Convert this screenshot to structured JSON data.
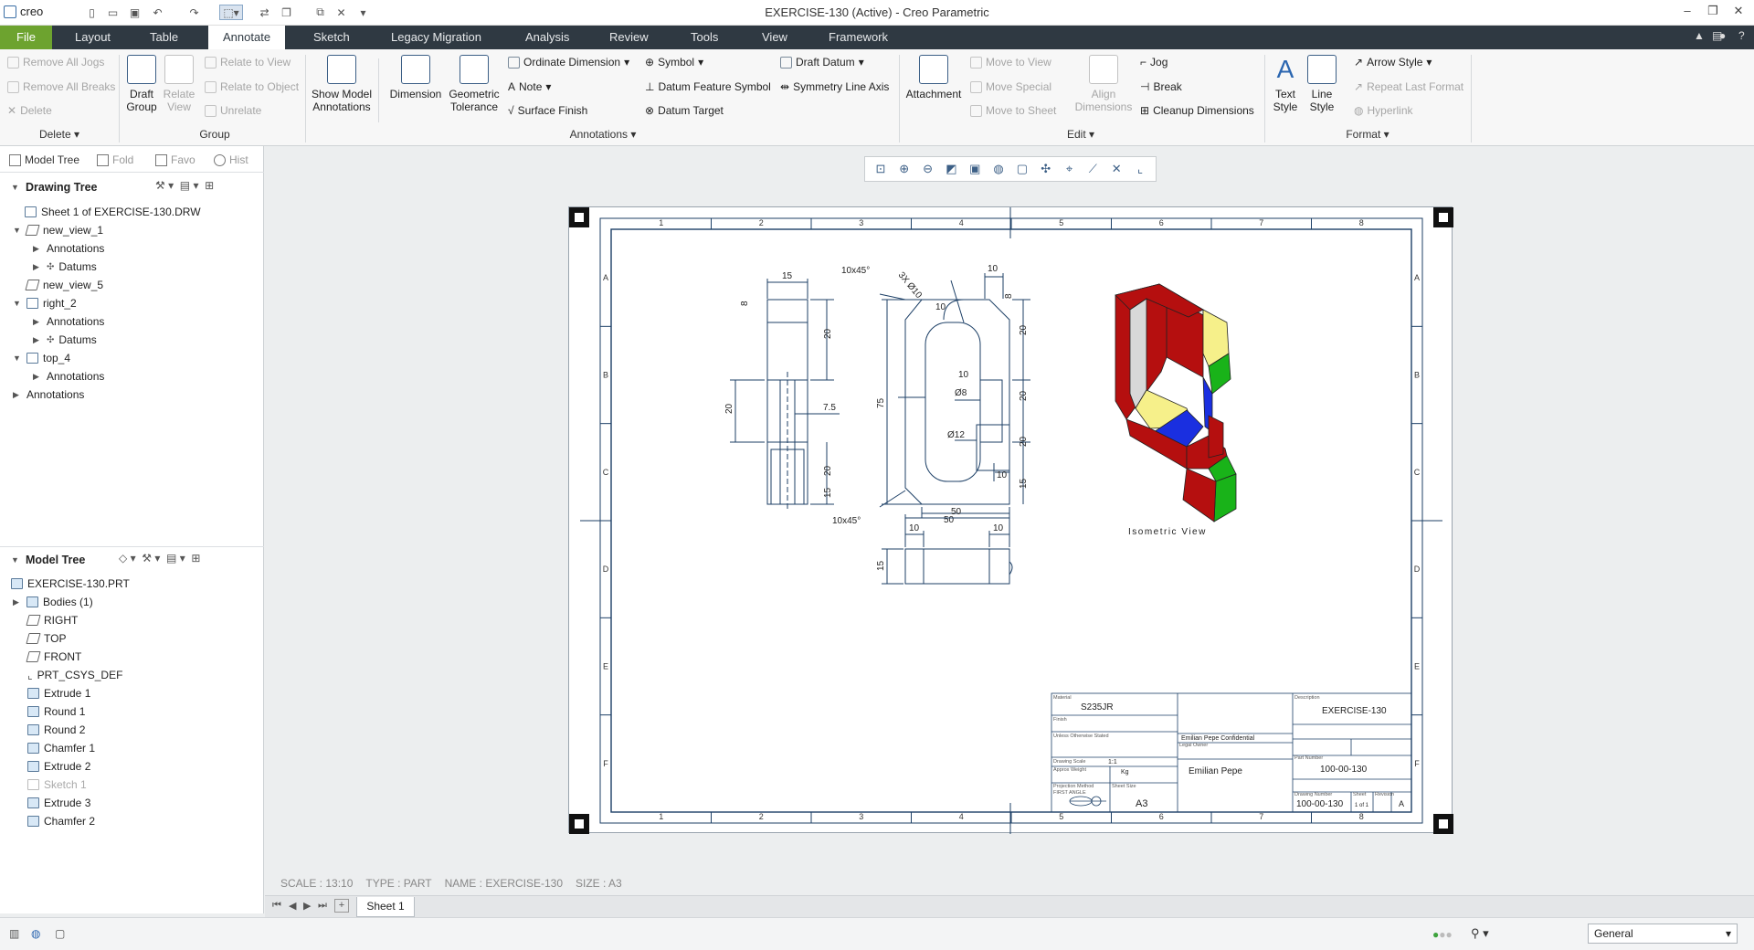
{
  "app": {
    "logo": "creo",
    "window_title": "EXERCISE-130 (Active) - Creo Parametric"
  },
  "menu": {
    "tabs": [
      "File",
      "Layout",
      "Table",
      "Annotate",
      "Sketch",
      "Legacy Migration",
      "Analysis",
      "Review",
      "Tools",
      "View",
      "Framework"
    ],
    "active_tab": "Annotate"
  },
  "ribbon": {
    "delete_group": {
      "items": [
        "Remove All Jogs",
        "Remove All Breaks",
        "Delete"
      ],
      "label": "Delete"
    },
    "group_group": {
      "draft_group": "Draft Group",
      "relate_view": "Relate View",
      "items": [
        "Relate to View",
        "Relate to Object",
        "Unrelate"
      ],
      "label": "Group"
    },
    "annotations_group": {
      "show_model": "Show Model Annotations",
      "dimension": "Dimension",
      "geometric_tolerance": "Geometric Tolerance",
      "ordinate_dimension": "Ordinate Dimension",
      "note": "Note",
      "surface_finish": "Surface Finish",
      "symbol": "Symbol",
      "datum_feature_symbol": "Datum Feature Symbol",
      "datum_target": "Datum Target",
      "draft_datum": "Draft Datum",
      "symmetry_line_axis": "Symmetry Line Axis",
      "label": "Annotations"
    },
    "edit_group": {
      "attachment": "Attachment",
      "move_items": [
        "Move to View",
        "Move Special",
        "Move to Sheet"
      ],
      "align_dimensions": "Align Dimensions",
      "jog": "Jog",
      "break": "Break",
      "cleanup": "Cleanup Dimensions",
      "label": "Edit"
    },
    "format_group": {
      "text_style": "Text Style",
      "line_style": "Line Style",
      "arrow_style": "Arrow Style",
      "repeat_last_format": "Repeat Last Format",
      "hyperlink": "Hyperlink",
      "label": "Format"
    }
  },
  "left_panel": {
    "tabs": [
      "Model Tree",
      "Fold",
      "Favo",
      "Hist"
    ],
    "drawing_tree": {
      "title": "Drawing Tree",
      "nodes": [
        "Sheet 1 of EXERCISE-130.DRW",
        "new_view_1",
        "Annotations",
        "Datums",
        "new_view_5",
        "right_2",
        "Annotations",
        "Datums",
        "top_4",
        "Annotations",
        "Annotations"
      ]
    },
    "model_tree": {
      "title": "Model Tree",
      "nodes": [
        "EXERCISE-130.PRT",
        "Bodies (1)",
        "RIGHT",
        "TOP",
        "FRONT",
        "PRT_CSYS_DEF",
        "Extrude 1",
        "Round 1",
        "Round 2",
        "Chamfer 1",
        "Extrude 2",
        "Sketch 1",
        "Extrude 3",
        "Chamfer 2"
      ]
    }
  },
  "drawing": {
    "border_cols": [
      "1",
      "2",
      "3",
      "4",
      "5",
      "6",
      "7",
      "8"
    ],
    "border_rows": [
      "A",
      "B",
      "C",
      "D",
      "E",
      "F"
    ],
    "dims": {
      "side": [
        "15",
        "8",
        "20",
        "20",
        "7.5",
        "20",
        "15"
      ],
      "front": [
        "10x45°",
        "3X Ø10",
        "10",
        "8",
        "20",
        "75",
        "10",
        "10",
        "Ø8",
        "20",
        "Ø12",
        "20",
        "10",
        "15",
        "10x45°",
        "50"
      ],
      "top": [
        "50",
        "10",
        "10",
        "15"
      ]
    },
    "iso_label": "Isometric View",
    "title_block": {
      "material_label": "Material",
      "material": "S235JR",
      "finish_label": "Finish",
      "tolerance_text": "Unless Otherwise Stated",
      "scale_label": "Drawing Scale",
      "scale": "1:1",
      "weight_label": "Approx Weight",
      "weight": "Kg",
      "projection_label": "Projection Method",
      "projection": "FIRST ANGLE",
      "size_label": "Sheet Size",
      "size": "A3",
      "confidential": "Emilian Pepe Confidential",
      "legal_owner_label": "Legal Owner",
      "legal_owner": "Emilian Pepe",
      "description_label": "Description",
      "description": "EXERCISE-130",
      "part_number_label": "Part Number",
      "part_number": "100-00-130",
      "drawing_number_label": "Drawing Number",
      "drawing_number": "100-00-130",
      "sheet_label": "Sheet",
      "sheet": "1 of 1",
      "revision_label": "Revision",
      "revision": "A"
    }
  },
  "status": {
    "scale": "SCALE : 13:10",
    "type": "TYPE : PART",
    "name": "NAME : EXERCISE-130",
    "size": "SIZE : A3",
    "sheet_tab": "Sheet 1",
    "filter": "General"
  },
  "colors": {
    "file_tab": "#6da32f",
    "menubar": "#2f3942",
    "part_red": "#b50f0f",
    "part_green": "#19b319",
    "part_yellow": "#f6f08a",
    "part_blue": "#1a2fe0"
  }
}
